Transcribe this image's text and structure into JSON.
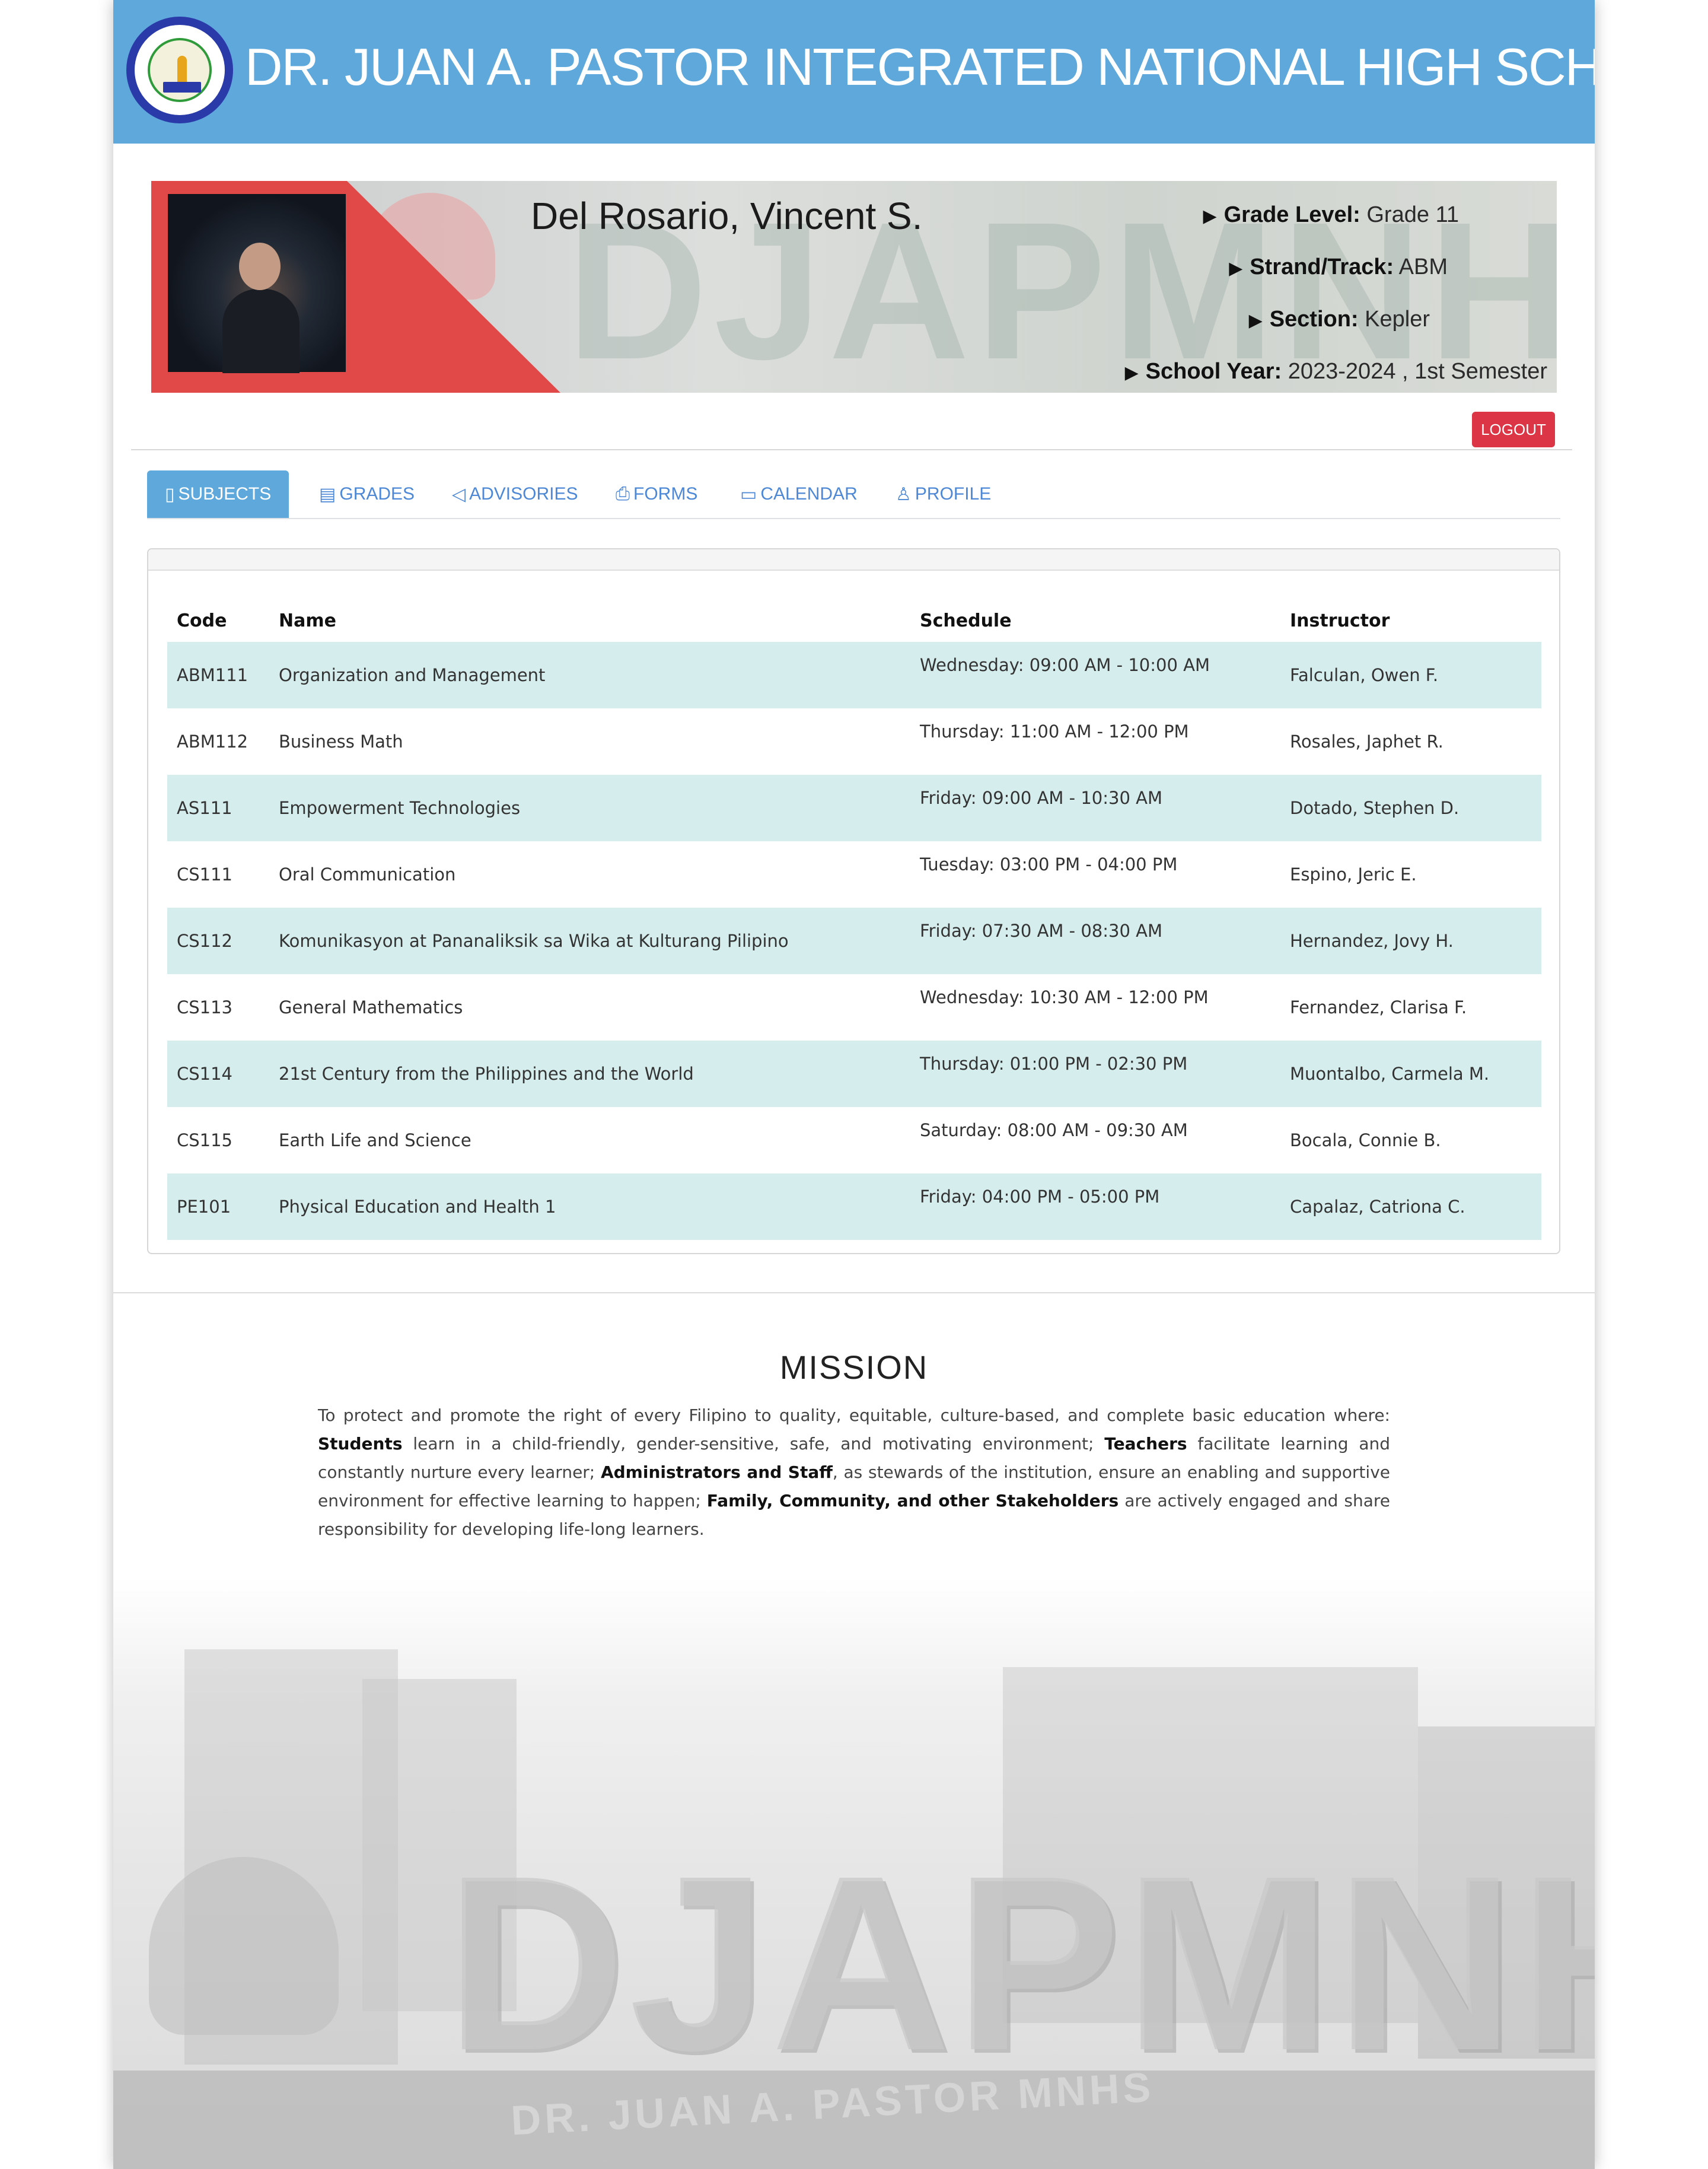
{
  "header": {
    "school_name": "DR. JUAN A. PASTOR INTEGRATED NATIONAL HIGH SCHOOL",
    "bg_color": "#5fa8dc"
  },
  "profile": {
    "name": "Del Rosario, Vincent S.",
    "grade_level_label": "Grade Level:",
    "grade_level": "Grade 11",
    "strand_label": "Strand/Track:",
    "strand": "ABM",
    "section_label": "Section:",
    "section": "Kepler",
    "school_year_label": "School Year:",
    "school_year": "2023-2024 , 1st Semester",
    "banner_watermark": "DJAPMNHS"
  },
  "logout_label": "LOGOUT",
  "tabs": [
    {
      "label": "SUBJECTS",
      "icon": "subjects-icon",
      "active": true
    },
    {
      "label": "GRADES",
      "icon": "grades-icon",
      "active": false
    },
    {
      "label": "ADVISORIES",
      "icon": "megaphone-icon",
      "active": false
    },
    {
      "label": "FORMS",
      "icon": "printer-icon",
      "active": false
    },
    {
      "label": "CALENDAR",
      "icon": "calendar-icon",
      "active": false
    },
    {
      "label": "PROFILE",
      "icon": "user-icon",
      "active": false
    }
  ],
  "subjects_table": {
    "headers": [
      "Code",
      "Name",
      "Schedule",
      "Instructor"
    ],
    "rows": [
      {
        "code": "ABM111",
        "name": "Organization and Management",
        "schedule": "Wednesday: 09:00 AM - 10:00 AM",
        "instructor": "Falculan, Owen F."
      },
      {
        "code": "ABM112",
        "name": "Business Math",
        "schedule": "Thursday: 11:00 AM - 12:00 PM",
        "instructor": "Rosales, Japhet R."
      },
      {
        "code": "AS111",
        "name": "Empowerment Technologies",
        "schedule": "Friday: 09:00 AM - 10:30 AM",
        "instructor": "Dotado, Stephen D."
      },
      {
        "code": "CS111",
        "name": "Oral Communication",
        "schedule": "Tuesday: 03:00 PM - 04:00 PM",
        "instructor": "Espino, Jeric E."
      },
      {
        "code": "CS112",
        "name": "Komunikasyon at Pananaliksik sa Wika at Kulturang Pilipino",
        "schedule": "Friday: 07:30 AM - 08:30 AM",
        "instructor": "Hernandez, Jovy H."
      },
      {
        "code": "CS113",
        "name": "General Mathematics",
        "schedule": "Wednesday: 10:30 AM - 12:00 PM",
        "instructor": "Fernandez, Clarisa F."
      },
      {
        "code": "CS114",
        "name": "21st Century from the Philippines and the World",
        "schedule": "Thursday: 01:00 PM - 02:30 PM",
        "instructor": "Muontalbo, Carmela M."
      },
      {
        "code": "CS115",
        "name": "Earth Life and Science",
        "schedule": "Saturday: 08:00 AM - 09:30 AM",
        "instructor": "Bocala, Connie B."
      },
      {
        "code": "PE101",
        "name": "Physical Education and Health 1",
        "schedule": "Friday: 04:00 PM - 05:00 PM",
        "instructor": "Capalaz, Catriona C."
      }
    ]
  },
  "mission": {
    "title": "MISSION",
    "intro": "To protect and promote the right of every Filipino to quality, equitable, culture-based, and complete basic education where: ",
    "students_label": "Students",
    "students_text": " learn in a child-friendly, gender-sensitive, safe, and motivating environment; ",
    "teachers_label": "Teachers",
    "teachers_text": " facilitate learning and constantly nurture every learner; ",
    "admin_label": "Administrators and Staff",
    "admin_text": ", as stewards of the institution, ensure an enabling and supportive environment for effective learning to happen; ",
    "family_label": "Family, Community, and other Stakeholders",
    "family_text": " are actively engaged and share responsibility for developing life-long learners."
  },
  "campus_sign": {
    "letters": "DJAPMNHS",
    "base_text": "DR. JUAN A. PASTOR MNHS"
  },
  "colors": {
    "accent": "#5fa8dc",
    "logout": "#dc3545",
    "row_stripe": "#d6eded",
    "banner_red": "#e14848"
  }
}
